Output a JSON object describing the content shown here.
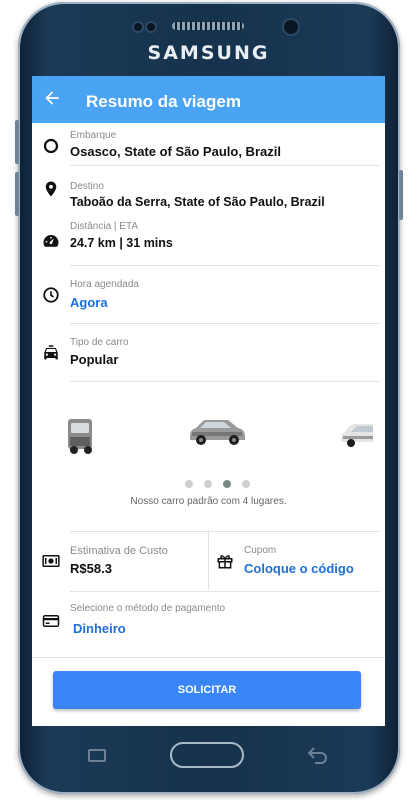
{
  "device": {
    "brand": "SAMSUNG"
  },
  "header": {
    "title": "Resumo da viagem"
  },
  "pickup": {
    "label": "Embarque",
    "value": "Osasco, State of São Paulo, Brazil"
  },
  "destination": {
    "label": "Destino",
    "value": "Taboão da Serra, State of São Paulo, Brazil"
  },
  "distance": {
    "label": "Distância | ETA",
    "value": "24.7 km | 31 mins"
  },
  "schedule": {
    "label": "Hora agendada",
    "value": "Agora"
  },
  "car_type": {
    "label": "Tipo de carro",
    "value": "Popular"
  },
  "carousel": {
    "slides": 4,
    "active_index": 2,
    "description": "Nosso carro padrão com 4 lugares."
  },
  "estimate": {
    "label": "Estimativa de Custo",
    "value": "R$58.3"
  },
  "coupon": {
    "label": "Cupom",
    "link": "Coloque o código"
  },
  "payment": {
    "label": "Selecione o método de pagamento",
    "value": "Dinheiro"
  },
  "cta": {
    "label": "SOLICITAR"
  },
  "colors": {
    "appbar": "#4aa3f3",
    "button": "#3b86f7",
    "link": "#1e6fd9"
  }
}
